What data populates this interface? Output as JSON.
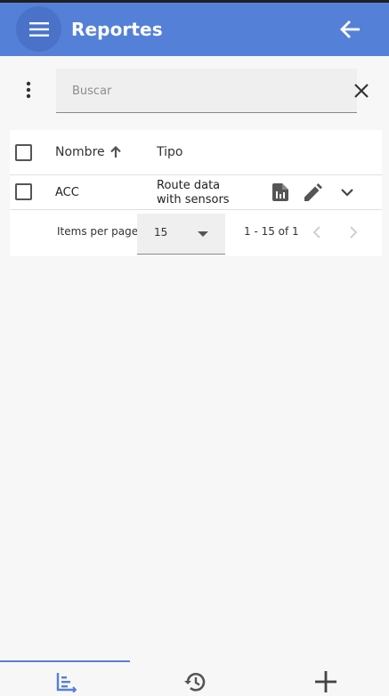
{
  "app": {
    "title": "Reportes",
    "menu_icon": "menu-icon",
    "back_icon": "arrow-back-icon",
    "accent_color": "#5580d8"
  },
  "search": {
    "placeholder": "Buscar",
    "value": "",
    "clear_icon": "close-icon",
    "more_icon": "more-vert-icon"
  },
  "table": {
    "columns": {
      "name": "Nombre",
      "type": "Tipo",
      "sort_icon": "arrow-up-icon"
    },
    "rows": [
      {
        "name": "ACC",
        "type_line1": "Route data",
        "type_line2": "with sensors",
        "actions": [
          "report-icon",
          "edit-icon",
          "expand-more-icon"
        ]
      }
    ]
  },
  "paginator": {
    "items_per_page_label": "Items per page",
    "page_size": "15",
    "range": "1 - 15 of 1",
    "prev_icon": "chevron-left-icon",
    "next_icon": "chevron-right-icon"
  },
  "bottom_nav": {
    "items": [
      {
        "icon": "chart-timeline-icon",
        "active": true
      },
      {
        "icon": "history-icon",
        "active": false
      },
      {
        "icon": "add-icon",
        "active": false
      }
    ]
  }
}
